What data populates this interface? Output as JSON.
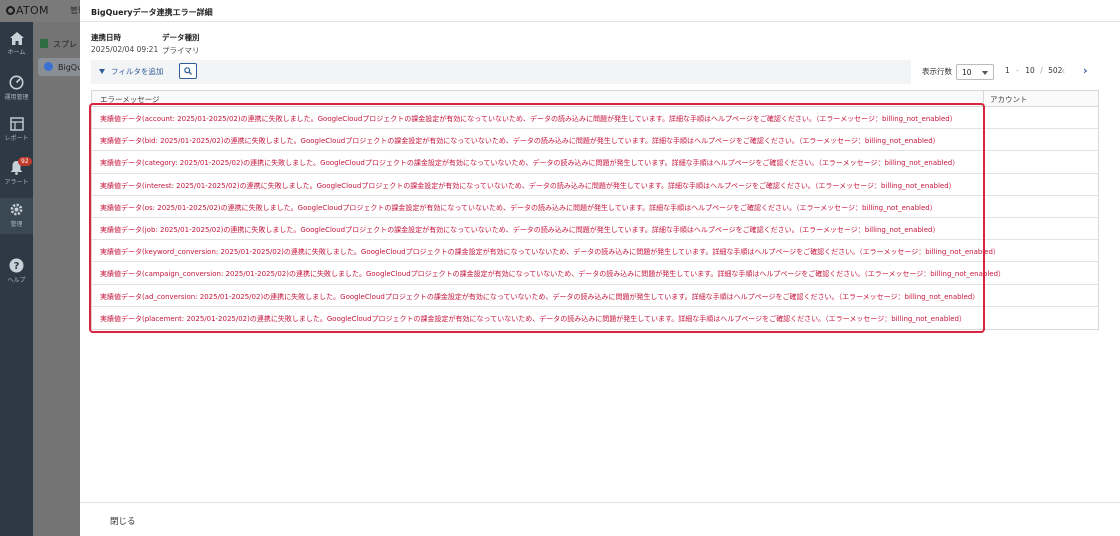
{
  "background": {
    "logo": "ATOM",
    "top_tab": "管理",
    "nav": [
      {
        "label": "ホーム",
        "icon": "home-icon"
      },
      {
        "label": "運用管理",
        "icon": "gauge-icon"
      },
      {
        "label": "レポート",
        "icon": "report-icon"
      },
      {
        "label": "アラート",
        "icon": "bell-icon",
        "badge": "92"
      },
      {
        "label": "管理",
        "icon": "gear-icon"
      },
      {
        "label": "ヘルプ",
        "icon": "help-icon"
      }
    ],
    "side_items": [
      "スプレ",
      "BigQu"
    ]
  },
  "modal": {
    "title": "BigQueryデータ連携エラー詳細",
    "meta": {
      "date_label": "連携日時",
      "date_value": "2025/02/04 09:21",
      "type_label": "データ種別",
      "type_value": "プライマリ"
    },
    "toolbar": {
      "filter_label": "フィルタを追加",
      "rows_label": "表示行数",
      "rows_value": "10",
      "range_start": "1",
      "range_sep": "-",
      "range_end": "10",
      "slash": "/",
      "total": "502"
    },
    "table": {
      "headers": [
        "エラーメッセージ",
        "アカウント"
      ],
      "rows": [
        "実績値データ(account: 2025/01-2025/02)の連携に失敗しました。GoogleCloudプロジェクトの課金設定が有効になっていないため、データの読み込みに問題が発生しています。詳細な手順はヘルプページをご確認ください。（エラーメッセージ：billing_not_enabled）",
        "実績値データ(bid: 2025/01-2025/02)の連携に失敗しました。GoogleCloudプロジェクトの課金設定が有効になっていないため、データの読み込みに問題が発生しています。詳細な手順はヘルプページをご確認ください。（エラーメッセージ：billing_not_enabled）",
        "実績値データ(category: 2025/01-2025/02)の連携に失敗しました。GoogleCloudプロジェクトの課金設定が有効になっていないため、データの読み込みに問題が発生しています。詳細な手順はヘルプページをご確認ください。（エラーメッセージ：billing_not_enabled）",
        "実績値データ(interest: 2025/01-2025/02)の連携に失敗しました。GoogleCloudプロジェクトの課金設定が有効になっていないため、データの読み込みに問題が発生しています。詳細な手順はヘルプページをご確認ください。（エラーメッセージ：billing_not_enabled）",
        "実績値データ(os: 2025/01-2025/02)の連携に失敗しました。GoogleCloudプロジェクトの課金設定が有効になっていないため、データの読み込みに問題が発生しています。詳細な手順はヘルプページをご確認ください。（エラーメッセージ：billing_not_enabled）",
        "実績値データ(job: 2025/01-2025/02)の連携に失敗しました。GoogleCloudプロジェクトの課金設定が有効になっていないため、データの読み込みに問題が発生しています。詳細な手順はヘルプページをご確認ください。（エラーメッセージ：billing_not_enabled）",
        "実績値データ(keyword_conversion: 2025/01-2025/02)の連携に失敗しました。GoogleCloudプロジェクトの課金設定が有効になっていないため、データの読み込みに問題が発生しています。詳細な手順はヘルプページをご確認ください。（エラーメッセージ：billing_not_enabled）",
        "実績値データ(campaign_conversion: 2025/01-2025/02)の連携に失敗しました。GoogleCloudプロジェクトの課金設定が有効になっていないため、データの読み込みに問題が発生しています。詳細な手順はヘルプページをご確認ください。（エラーメッセージ：billing_not_enabled）",
        "実績値データ(ad_conversion: 2025/01-2025/02)の連携に失敗しました。GoogleCloudプロジェクトの課金設定が有効になっていないため、データの読み込みに問題が発生しています。詳細な手順はヘルプページをご確認ください。（エラーメッセージ：billing_not_enabled）",
        "実績値データ(placement: 2025/01-2025/02)の連携に失敗しました。GoogleCloudプロジェクトの課金設定が有効になっていないため、データの読み込みに問題が発生しています。詳細な手順はヘルプページをご確認ください。（エラーメッセージ：billing_not_enabled）"
      ]
    },
    "close_label": "閉じる"
  },
  "colors": {
    "error_text": "#c5153d",
    "highlight_border": "#d9233f",
    "accent": "#2f5d9a"
  }
}
